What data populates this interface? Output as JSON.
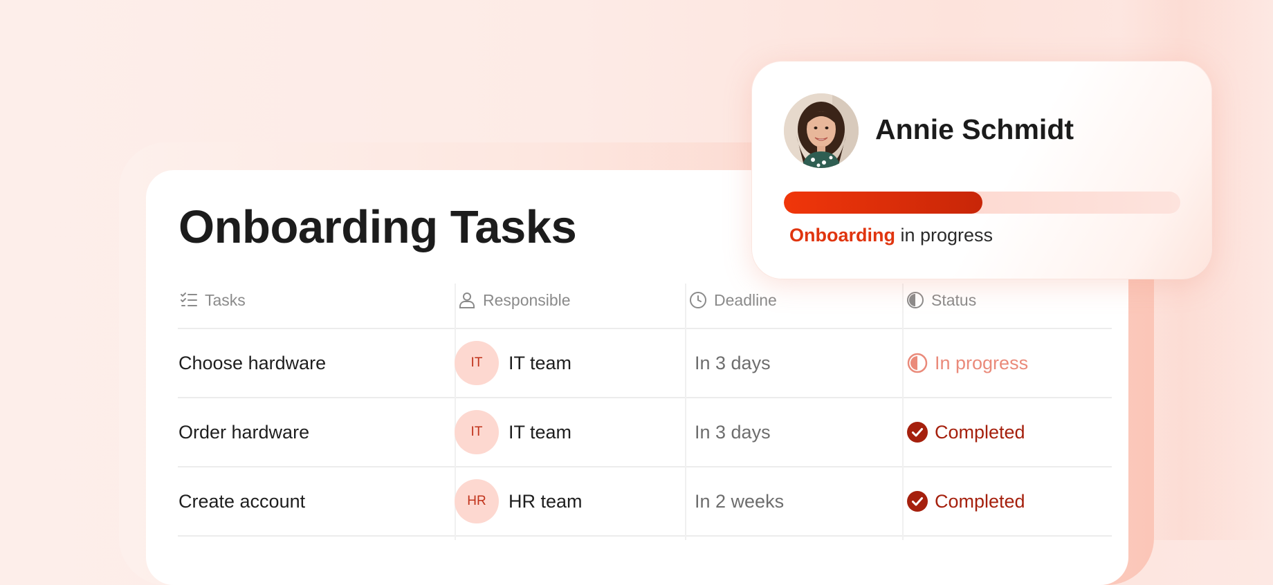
{
  "page": {
    "title": "Onboarding Tasks"
  },
  "table": {
    "headers": [
      {
        "label": "Tasks",
        "icon": "checklist-icon"
      },
      {
        "label": "Responsible",
        "icon": "person-icon"
      },
      {
        "label": "Deadline",
        "icon": "clock-icon"
      },
      {
        "label": "Status",
        "icon": "half-circle-icon"
      }
    ],
    "rows": [
      {
        "task": "Choose hardware",
        "badge": "IT",
        "responsible": "IT team",
        "deadline": "In 3 days",
        "status": "In progress",
        "status_icon": "half-circle-icon"
      },
      {
        "task": "Order hardware",
        "badge": "IT",
        "responsible": "IT team",
        "deadline": "In 3 days",
        "status": "Completed",
        "status_icon": "check-circle-icon"
      },
      {
        "task": "Create account",
        "badge": "HR",
        "responsible": "HR team",
        "deadline": "In 2 weeks",
        "status": "Completed",
        "status_icon": "check-circle-icon"
      }
    ]
  },
  "profile": {
    "name": "Annie Schmidt",
    "progress_fraction": 0.5,
    "status_accent": "Onboarding",
    "status_rest": " in progress"
  },
  "colors": {
    "accent": "#e0350f",
    "in_progress": "#ea8a7a",
    "completed": "#a5200d",
    "badge_bg": "#fdd8d0"
  }
}
